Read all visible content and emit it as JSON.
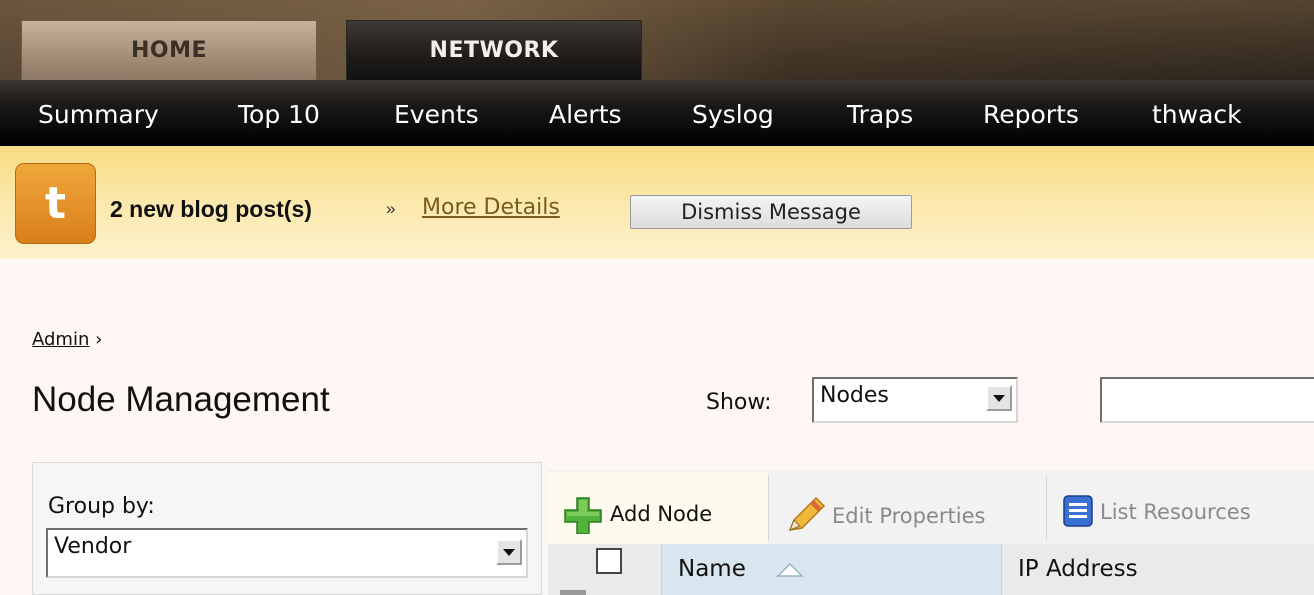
{
  "header": {
    "tabs": [
      {
        "label": "HOME",
        "active": true
      },
      {
        "label": "NETWORK",
        "active": false
      }
    ],
    "subnav": [
      "Summary",
      "Top 10",
      "Events",
      "Alerts",
      "Syslog",
      "Traps",
      "Reports",
      "thwack"
    ]
  },
  "notification": {
    "logo_letter": "t",
    "message": "2 new blog post(s)",
    "separator": "»",
    "link": "More Details",
    "dismiss": "Dismiss Message"
  },
  "breadcrumb": {
    "link": "Admin",
    "separator": "›"
  },
  "page": {
    "title": "Node Management"
  },
  "filter": {
    "show_label": "Show:",
    "show_value": "Nodes",
    "search_value": ""
  },
  "group_by": {
    "label": "Group by:",
    "value": "Vendor"
  },
  "toolbar": {
    "add_node": "Add Node",
    "edit_properties": "Edit Properties",
    "list_resources": "List Resources"
  },
  "grid": {
    "columns": [
      {
        "label": "Name",
        "sorted": "ascending"
      },
      {
        "label": "IP Address"
      }
    ]
  },
  "colors": {
    "notification_bg": "#fbe7a8",
    "logo_orange": "#e38a22",
    "link_brown": "#7a5a1e",
    "sorted_column": "#d7e6ef"
  }
}
